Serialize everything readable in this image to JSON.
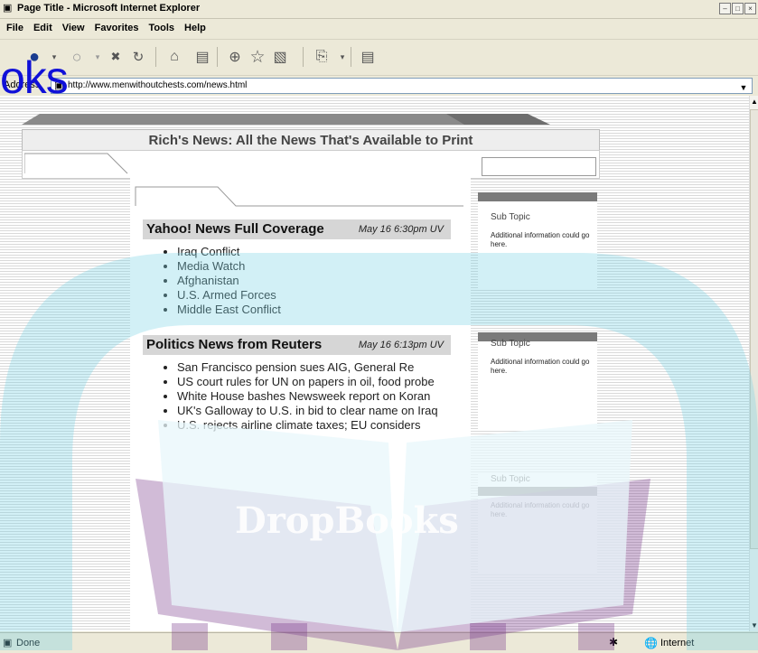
{
  "window": {
    "title": "Page Title - Microsoft Internet Explorer",
    "controls": [
      "minimize",
      "maximize",
      "close"
    ]
  },
  "menu": [
    {
      "label": "File"
    },
    {
      "label": "Edit"
    },
    {
      "label": "View"
    },
    {
      "label": "Favorites"
    },
    {
      "label": "Tools"
    },
    {
      "label": "Help"
    }
  ],
  "toolbar": {
    "buttons": [
      "back-icon",
      "forward-icon",
      "stop-icon",
      "refresh-icon",
      "home-icon",
      "history-icon",
      "media-icon",
      "favorites-icon",
      "print-icon",
      "edit-icon",
      "messenger-icon"
    ]
  },
  "address": {
    "label": "Address",
    "url": "http://www.menwithoutchests.com/news.html"
  },
  "overlay": {
    "watermark_text": "oks",
    "book_text": "DropBooks"
  },
  "page": {
    "banner_title": "Rich's News: All the News That's Available to Print",
    "news": [
      {
        "heading": "Yahoo! News Full Coverage",
        "time": "May 16 6:30pm UV",
        "items": [
          "Iraq Conflict",
          "Media Watch",
          "Afghanistan",
          "U.S. Armed Forces",
          "Middle East Conflict"
        ]
      },
      {
        "heading": "Politics News from Reuters",
        "time": "May 16 6:13pm UV",
        "items": [
          "San Francisco pension sues AIG, General Re",
          "US court rules for UN on papers in oil, food probe",
          "White House bashes Newsweek report on Koran",
          "UK's Galloway to U.S. in bid to clear name on Iraq",
          "U.S. rejects airline climate taxes; EU considers"
        ]
      }
    ],
    "sidebar": [
      {
        "title": "Sub Topic",
        "text": "Additional information could go here."
      },
      {
        "title": "Sub Topic",
        "text": "Additional information could go here."
      },
      {
        "title": "Sub Topic",
        "text": "Additional information could go here."
      }
    ]
  },
  "status": {
    "text": "Done",
    "zone": "Internet"
  },
  "colors": {
    "chrome": "#ece9d8",
    "watermark_blue": "#1010d8",
    "watermark_cyan": "#7fd3e6",
    "watermark_purple": "#7a3c8c"
  }
}
